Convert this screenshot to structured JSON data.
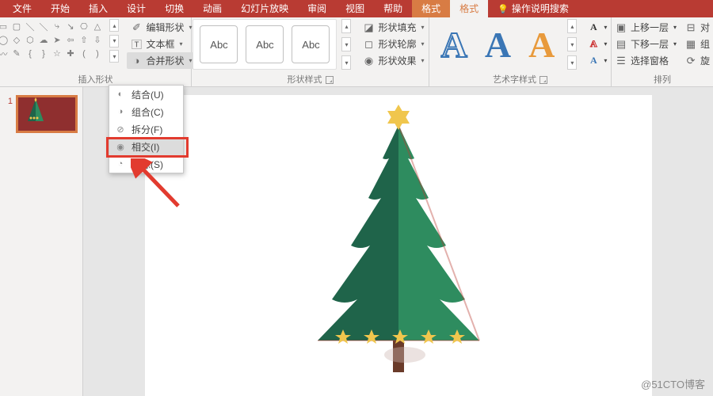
{
  "tabs": {
    "file": "文件",
    "home": "开始",
    "insert": "插入",
    "design": "设计",
    "transition": "切换",
    "animation": "动画",
    "slideshow": "幻灯片放映",
    "review": "审阅",
    "view": "视图",
    "help": "帮助",
    "format1": "格式",
    "format2": "格式",
    "tell_me": "操作说明搜索"
  },
  "insert_shapes": {
    "group_label": "插入形状",
    "edit_shape": "编辑形状",
    "text_box": "文本框",
    "merge_shapes": "合并形状"
  },
  "shape_styles": {
    "group_label": "形状样式",
    "abc_sample": "Abc",
    "fill": "形状填充",
    "outline": "形状轮廓",
    "effects": "形状效果"
  },
  "wordart": {
    "group_label": "艺术字样式",
    "letter": "A"
  },
  "arrange": {
    "group_label": "排列",
    "bring_forward": "上移一层",
    "send_backward": "下移一层",
    "selection_pane": "选择窗格",
    "align": "对",
    "group": "组",
    "rotate": "旋"
  },
  "merge_menu": {
    "union": "结合(U)",
    "combine": "组合(C)",
    "fragment": "拆分(F)",
    "intersect": "相交(I)",
    "subtract": "剪除(S)"
  },
  "slides": {
    "current_num": "1"
  },
  "watermark": "@51CTO博客"
}
